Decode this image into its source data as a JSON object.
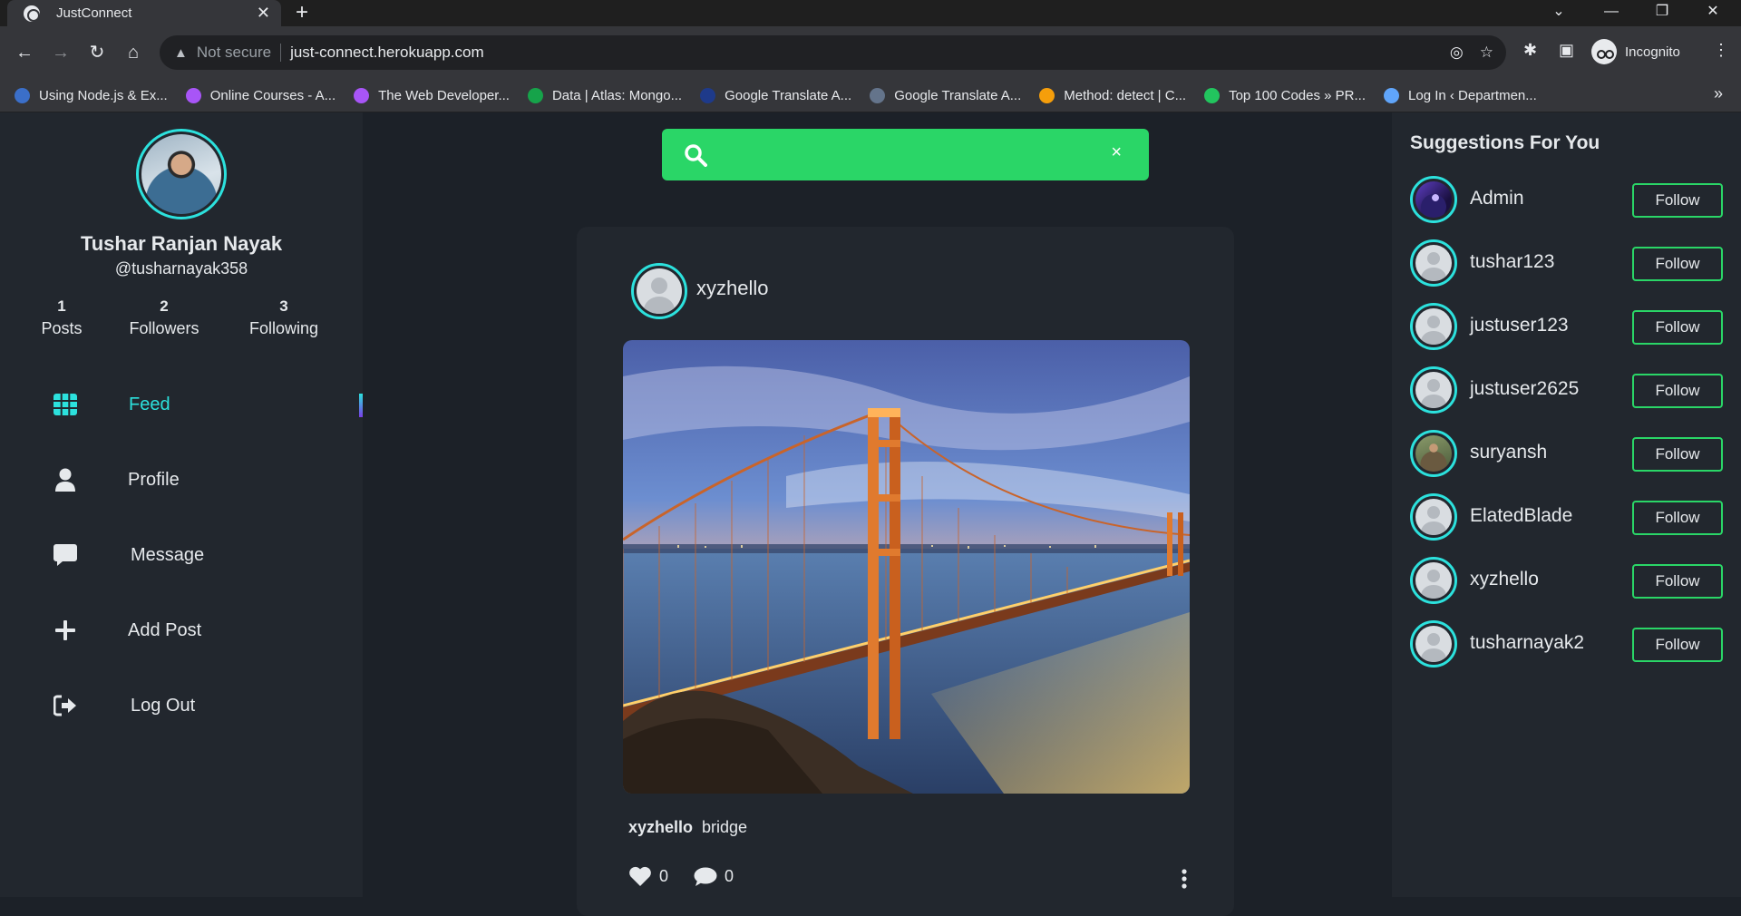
{
  "browser": {
    "tab_title": "JustConnect",
    "new_tab": "+",
    "not_secure": "Not secure",
    "url": "just-connect.herokuapp.com",
    "incognito_label": "Incognito",
    "bookmarks": [
      {
        "label": "Using Node.js & Ex...",
        "color": "#3b6fc9"
      },
      {
        "label": "Online Courses - A...",
        "color": "#a855f7"
      },
      {
        "label": "The Web Developer...",
        "color": "#a855f7"
      },
      {
        "label": "Data | Atlas: Mongo...",
        "color": "#16a34a"
      },
      {
        "label": "Google Translate A...",
        "color": "#1e3a8a"
      },
      {
        "label": "Google Translate A...",
        "color": "#64748b"
      },
      {
        "label": "Method: detect  |  C...",
        "color": "#f59e0b"
      },
      {
        "label": "Top 100 Codes » PR...",
        "color": "#22c55e"
      },
      {
        "label": "Log In ‹ Departmen...",
        "color": "#60a5fa"
      }
    ]
  },
  "profile": {
    "name": "Tushar Ranjan Nayak",
    "handle": "@tusharnayak358",
    "stats": [
      {
        "value": "1",
        "label": "Posts"
      },
      {
        "value": "2",
        "label": "Followers"
      },
      {
        "value": "3",
        "label": "Following"
      }
    ]
  },
  "nav": {
    "items": [
      {
        "label": "Feed",
        "icon": "grid-icon",
        "active": true
      },
      {
        "label": "Profile",
        "icon": "user-icon"
      },
      {
        "label": "Message",
        "icon": "message-icon"
      },
      {
        "label": "Add Post",
        "icon": "plus-icon"
      },
      {
        "label": "Log Out",
        "icon": "logout-icon"
      }
    ]
  },
  "search": {
    "placeholder": "",
    "clear": "×"
  },
  "post": {
    "username": "xyzhello",
    "caption_user": "xyzhello",
    "caption_text": "bridge",
    "likes": "0",
    "comments": "0"
  },
  "suggestions": {
    "title": "Suggestions For You",
    "follow_label": "Follow",
    "users": [
      {
        "name": "Admin",
        "avatar": "admin"
      },
      {
        "name": "tushar123",
        "avatar": "default"
      },
      {
        "name": "justuser123",
        "avatar": "default"
      },
      {
        "name": "justuser2625",
        "avatar": "default"
      },
      {
        "name": "suryansh",
        "avatar": "photo"
      },
      {
        "name": "ElatedBlade",
        "avatar": "default"
      },
      {
        "name": "xyzhello",
        "avatar": "default"
      },
      {
        "name": "tusharnayak2",
        "avatar": "default"
      }
    ]
  },
  "colors": {
    "accent": "#2ce1dd",
    "search_bg": "#2ad667",
    "follow_border": "#2ad667"
  }
}
